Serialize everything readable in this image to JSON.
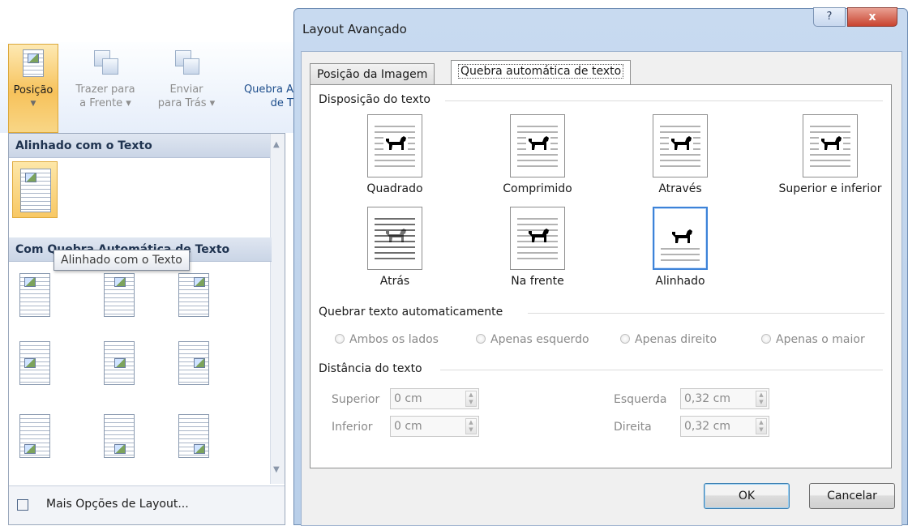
{
  "ribbon": {
    "posicao": {
      "label": "Posição"
    },
    "trazer": {
      "line1": "Trazer para",
      "line2": "a Frente"
    },
    "enviar": {
      "line1": "Enviar",
      "line2": "para Trás"
    },
    "quebra": {
      "line1": "Quebra A",
      "line2": "de T"
    }
  },
  "dropdown": {
    "section1": "Alinhado com o Texto",
    "section2": "Com Quebra Automática de Texto",
    "tooltip": "Alinhado com o Texto",
    "more_label": "Mais Opções de Layout..."
  },
  "dialog": {
    "title": "Layout Avançado",
    "help": "?",
    "close": "x",
    "tabs": [
      "Posição da Imagem",
      "Quebra automática de texto"
    ],
    "disposicao": "Disposição do texto",
    "wrap_options": [
      "Quadrado",
      "Comprimido",
      "Através",
      "Superior e inferior",
      "Atrás",
      "Na frente",
      "Alinhado"
    ],
    "quebrar": "Quebrar texto automaticamente",
    "radios": [
      "Ambos os lados",
      "Apenas esquerdo",
      "Apenas direito",
      "Apenas o maior"
    ],
    "distancia": "Distância do texto",
    "fields": {
      "superior": {
        "label": "Superior",
        "value": "0 cm"
      },
      "inferior": {
        "label": "Inferior",
        "value": "0 cm"
      },
      "esquerda": {
        "label": "Esquerda",
        "value": "0,32 cm"
      },
      "direita": {
        "label": "Direita",
        "value": "0,32 cm"
      }
    },
    "ok": "OK",
    "cancel": "Cancelar"
  }
}
